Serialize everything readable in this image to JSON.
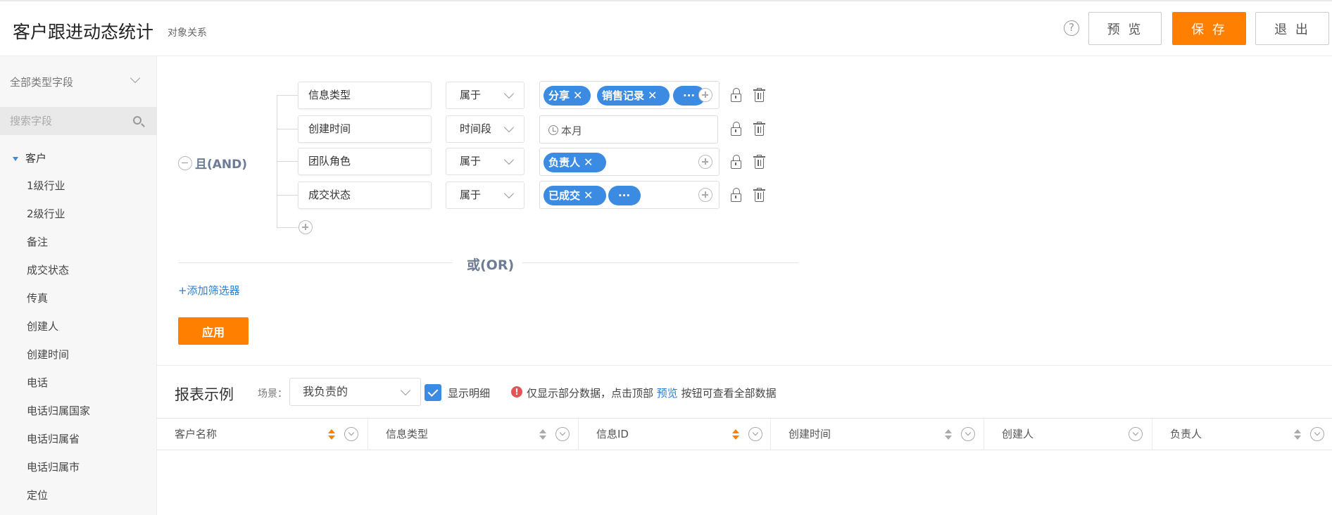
{
  "header": {
    "title": "客户跟进动态统计",
    "subtitle": "对象关系",
    "help_icon": "?",
    "preview_label": "预 览",
    "save_label": "保 存",
    "exit_label": "退 出"
  },
  "colors": {
    "accent": "#ff7f00",
    "tag": "#3b8be3",
    "link": "#2a7fd4"
  },
  "sidebar": {
    "type_select": "全部类型字段",
    "search_placeholder": "搜索字段",
    "group": "客户",
    "items": [
      "1级行业",
      "2级行业",
      "备注",
      "成交状态",
      "传真",
      "创建人",
      "创建时间",
      "电话",
      "电话归属国家",
      "电话归属省",
      "电话归属市",
      "定位"
    ]
  },
  "filter": {
    "and_label": "且(AND)",
    "rows": [
      {
        "field": "信息类型",
        "operator": "属于",
        "tags": [
          "分享",
          "销售记录",
          "···"
        ]
      },
      {
        "field": "创建时间",
        "operator": "时间段",
        "value": "本月"
      },
      {
        "field": "团队角色",
        "operator": "属于",
        "tags": [
          "负责人"
        ]
      },
      {
        "field": "成交状态",
        "operator": "属于",
        "tags": [
          "已成交",
          "···"
        ]
      }
    ],
    "or_label": "或(OR)",
    "add_filter": "+添加筛选器",
    "apply": "应用"
  },
  "report": {
    "title": "报表示例",
    "scene_label": "场景：",
    "scene_value": "我负责的",
    "show_detail": "显示明细",
    "show_detail_checked": true,
    "notice_before": "仅显示部分数据，点击顶部",
    "notice_link": "预览",
    "notice_after": "按钮可查看全部数据",
    "columns": [
      "客户名称",
      "信息类型",
      "信息ID",
      "创建时间",
      "创建人",
      "负责人"
    ]
  }
}
